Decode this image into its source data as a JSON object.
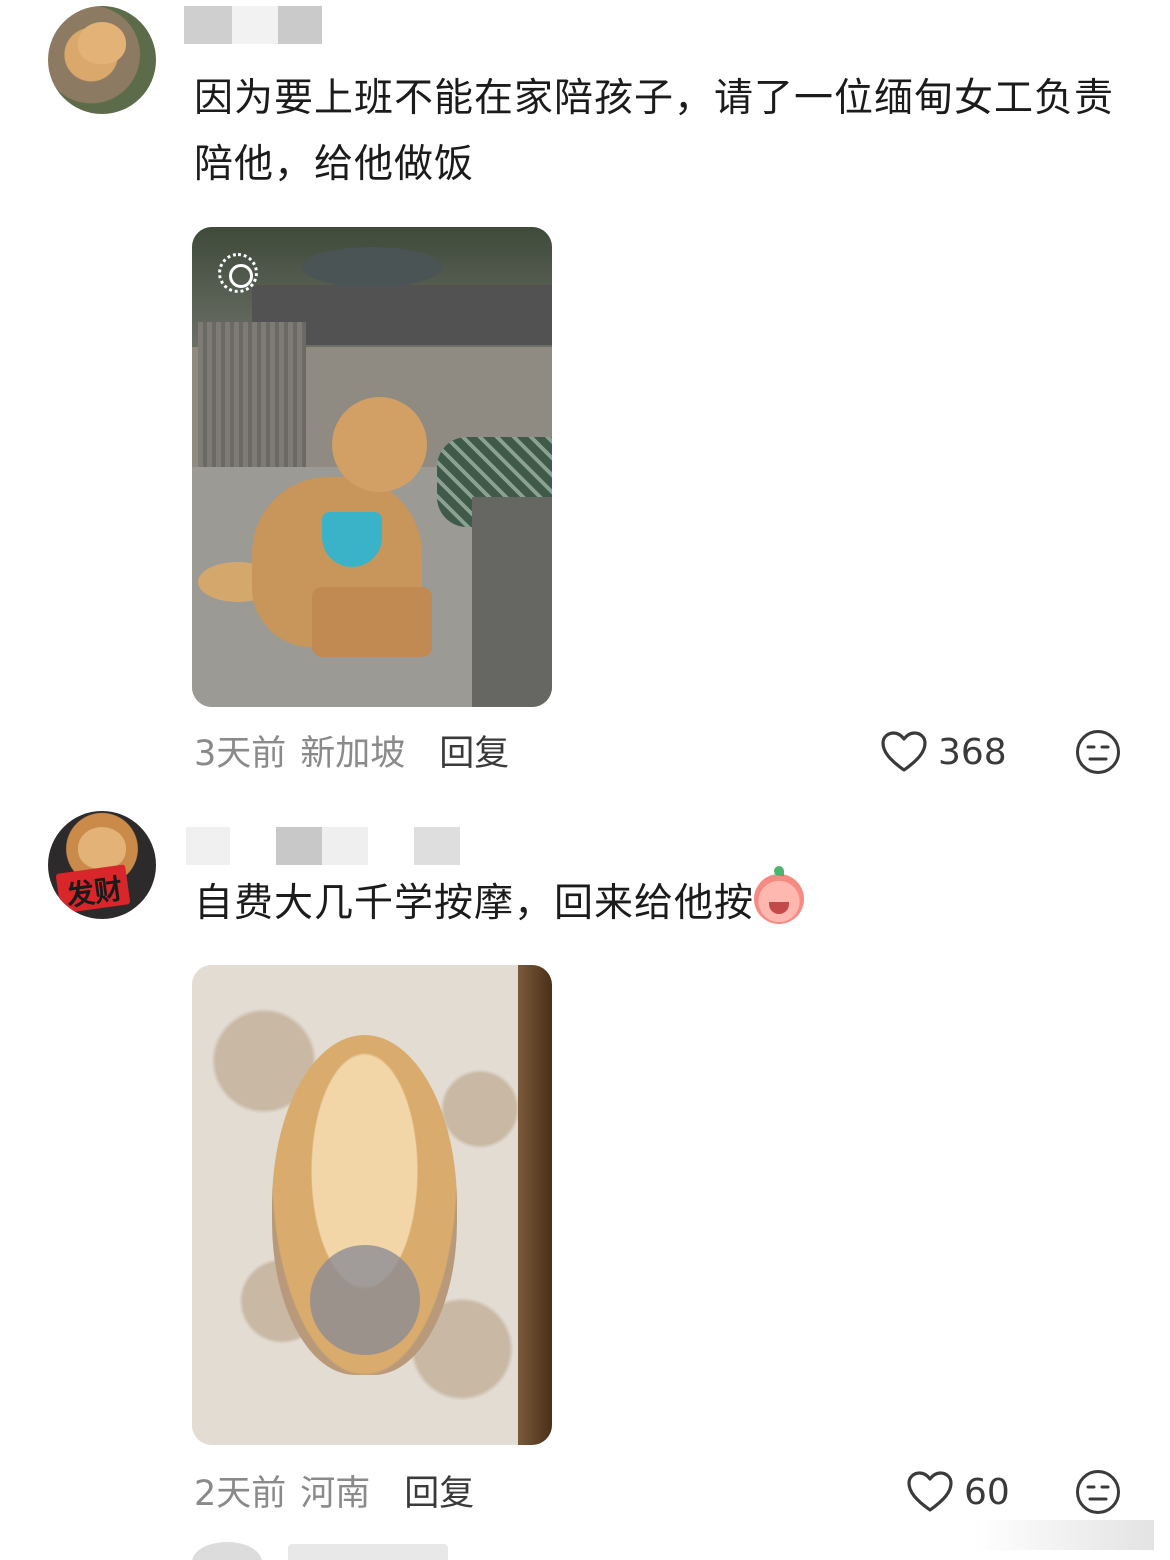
{
  "comments": [
    {
      "text": "因为要上班不能在家陪孩子，请了一位缅甸女工负责陪他，给他做饭",
      "time": "3天前",
      "location": "新加坡",
      "reply_label": "回复",
      "like_count": "368"
    },
    {
      "text": "自费大几千学按摩，回来给他按",
      "emoji": "crying-laughing-emoji",
      "time": "2天前",
      "location": "河南",
      "reply_label": "回复",
      "like_count": "60"
    }
  ],
  "avatars": [
    {
      "label": ""
    },
    {
      "label": "发财"
    }
  ],
  "colors": {
    "text": "#1b1b1b",
    "meta": "#8a8a8a",
    "reply": "#3a3a3a"
  }
}
